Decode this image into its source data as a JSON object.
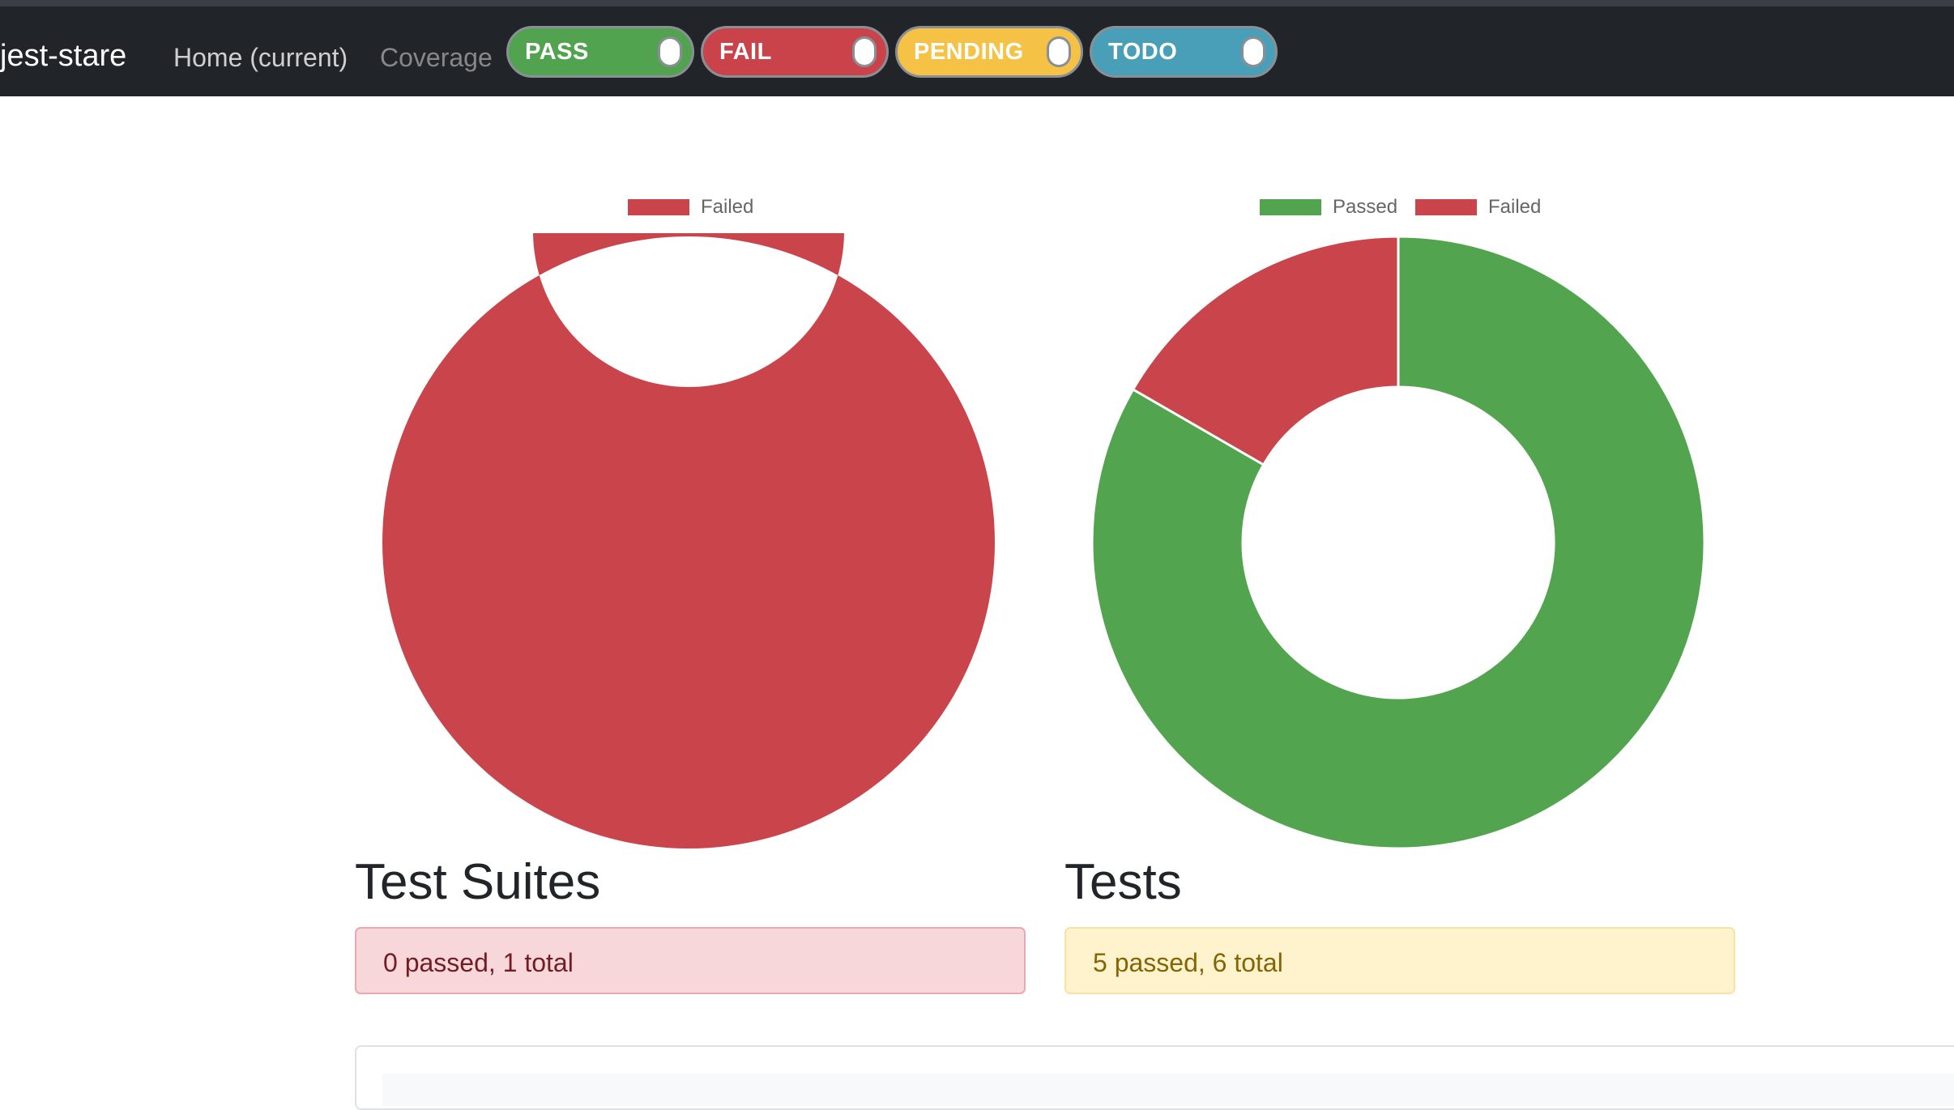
{
  "navbar": {
    "brand": "jest-stare",
    "links": [
      {
        "label": "Home (current)"
      },
      {
        "label": "Coverage"
      }
    ],
    "toggles": [
      {
        "label": "PASS",
        "color": "#52a350"
      },
      {
        "label": "FAIL",
        "color": "#ca434b"
      },
      {
        "label": "PENDING",
        "color": "#f5c245"
      },
      {
        "label": "TODO",
        "color": "#4a9fb8"
      }
    ]
  },
  "colors": {
    "passed": "#52a44f",
    "failed": "#ca444b"
  },
  "chart_data": [
    {
      "type": "pie",
      "categories": [
        "Failed"
      ],
      "values": [
        1
      ],
      "legend": "top",
      "donut": true
    },
    {
      "type": "pie",
      "categories": [
        "Passed",
        "Failed"
      ],
      "values": [
        5,
        1
      ],
      "legend": "top",
      "donut": true
    }
  ],
  "suites": {
    "title": "Test Suites",
    "summary": "0 passed, 1 total"
  },
  "tests": {
    "title": "Tests",
    "summary": "5 passed, 6 total"
  }
}
